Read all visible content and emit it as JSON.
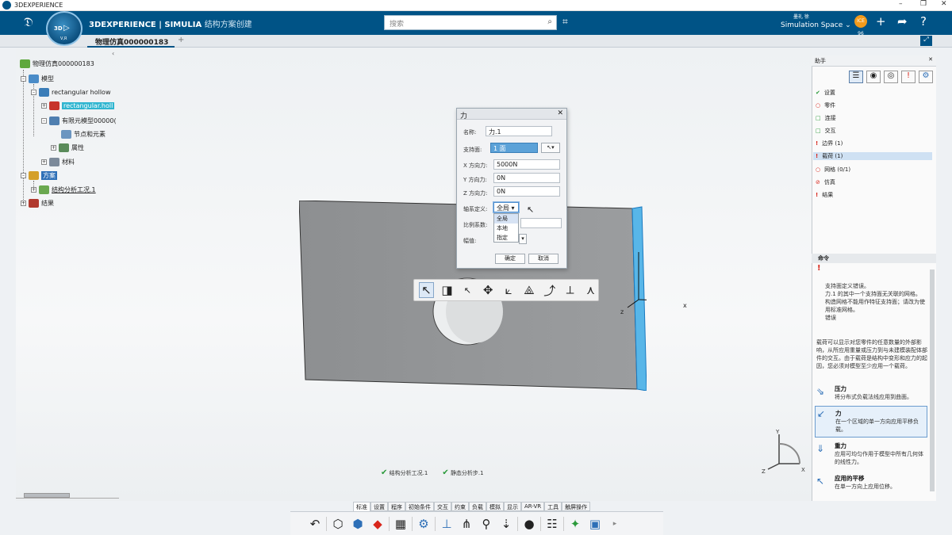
{
  "window": {
    "title": "3DEXPERIENCE",
    "min": "–",
    "restore": "❐",
    "close": "✕"
  },
  "header": {
    "brand_main": "3DEXPERIENCE | SIMULIA",
    "brand_sub": "结构方案创建",
    "compass_label": "3D",
    "compass_sub": "V,R",
    "search_placeholder": "搜索",
    "user_name": "墨礼 徐",
    "space": "Simulation Space ⌄",
    "avatar_text": "ICE 96"
  },
  "tabs": [
    {
      "label": "物理仿真000000183"
    }
  ],
  "tree": {
    "root": "物理仿真000000183",
    "model": "模型",
    "part": "rectangular hollow",
    "part_child": "rectangular.holl",
    "fem": "有限元模型00000(",
    "nodes": "节点和元素",
    "props": "属性",
    "material": "材料",
    "scenario": "方案",
    "case": "结构分析工况.1",
    "results": "结果"
  },
  "dialog": {
    "title": "力",
    "name_label": "名称:",
    "name_value": "力.1",
    "support_label": "支持面:",
    "support_value": "1 面",
    "fx_label": "X 方向力:",
    "fx_value": "5000N",
    "fy_label": "Y 方向力:",
    "fy_value": "0N",
    "fz_label": "Z 方向力:",
    "fz_value": "0N",
    "axis_label": "轴系定义:",
    "axis_value": "全局",
    "axis_options": [
      "全局",
      "本地",
      "指定"
    ],
    "scale_label": "比例系数:",
    "amp_label": "幅值:",
    "ok": "确定",
    "cancel": "取消"
  },
  "axes": {
    "x": "x",
    "z": "z"
  },
  "status": {
    "case": "结构分析工况.1",
    "step": "静态分析步.1"
  },
  "assistant": {
    "title": "助手",
    "items": [
      {
        "label": "设置",
        "mark": "✔",
        "color": "#2b9a3b"
      },
      {
        "label": "零件",
        "mark": "○",
        "color": "#d8261b"
      },
      {
        "label": "连接",
        "mark": "□",
        "color": "#2b9a3b"
      },
      {
        "label": "交互",
        "mark": "□",
        "color": "#2b9a3b"
      },
      {
        "label": "边界 (1)",
        "mark": "!",
        "color": "#d8261b"
      },
      {
        "label": "载荷 (1)",
        "mark": "!",
        "color": "#d8261b"
      },
      {
        "label": "网格 (0/1)",
        "mark": "○",
        "color": "#d8261b"
      },
      {
        "label": "仿真",
        "mark": "⊘",
        "color": "#d8261b"
      },
      {
        "label": "结果",
        "mark": "!",
        "color": "#d8261b"
      }
    ],
    "cmd_title": "命令",
    "warning_mark": "!",
    "msg_lines": [
      "支持面定义错误。",
      "力.1 的其中一个支持面无关联的网格。",
      "构造网格不能用作特征支持面；请改为使用标准网格。",
      "错误"
    ],
    "desc": "载荷可以显示对您零件的任意数量的外部影响，从所应用重量或压力到与未建模装配体部件的交互。由于载荷是结构中变形和应力的起因，您必须对模型至少应用一个载荷。",
    "commands": [
      {
        "name": "压力",
        "desc": "将分布式负载法线应用到曲面。",
        "icon": "⇘"
      },
      {
        "name": "力",
        "desc": "在一个区域的单一方向应用平移负载。",
        "icon": "↙"
      },
      {
        "name": "重力",
        "desc": "应用可均匀作用于模型中所有几何体的线性力。",
        "icon": "⇓"
      },
      {
        "name": "应用的平移",
        "desc": "在单一方向上应用位移。",
        "icon": "↖"
      }
    ]
  },
  "action_tabs": [
    "标准",
    "设置",
    "程序",
    "初始条件",
    "交互",
    "约束",
    "负载",
    "模拟",
    "显示",
    "AR-VR",
    "工具",
    "触屏操作"
  ],
  "robot": {
    "y": "Y",
    "z": "Z",
    "x": "X"
  }
}
